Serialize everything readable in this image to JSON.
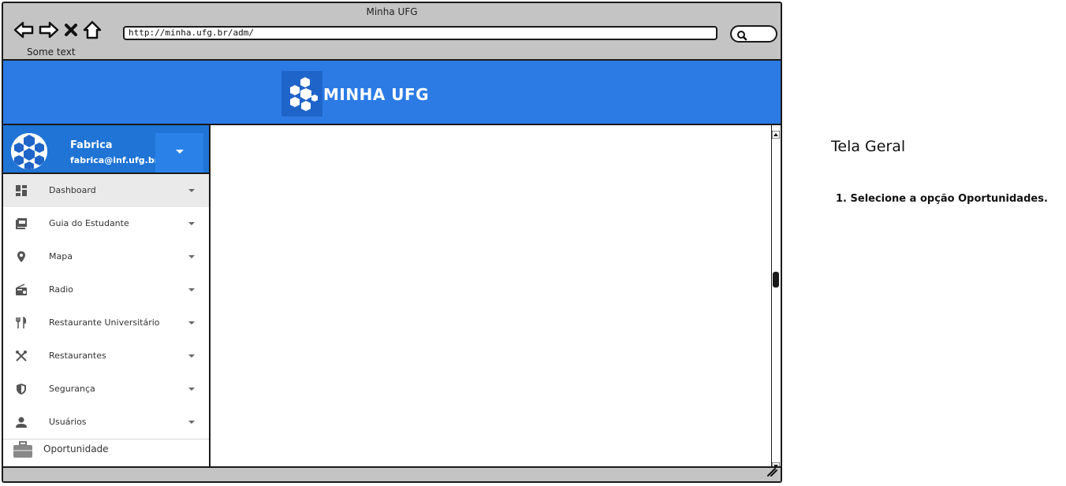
{
  "window": {
    "title": "Minha UFG",
    "url": "http://minha.ufg.br/adm/",
    "status_text": "Some text"
  },
  "browser_icons": [
    "back-icon",
    "forward-icon",
    "close-icon",
    "home-icon"
  ],
  "brand": {
    "name": "MINHA UFG",
    "color": "#2c7be5"
  },
  "profile": {
    "name": "Fabrica",
    "email": "fabrica@inf.ufg.br"
  },
  "menu": {
    "items": [
      {
        "label": "Dashboard",
        "icon": "dashboard-icon"
      },
      {
        "label": "Guia do Estudante",
        "icon": "pdf-icon"
      },
      {
        "label": "Mapa",
        "icon": "map-pin-icon"
      },
      {
        "label": "Radio",
        "icon": "radio-icon"
      },
      {
        "label": "Restaurante Universitário",
        "icon": "utensils-icon"
      },
      {
        "label": "Restaurantes",
        "icon": "crossed-utensils-icon"
      },
      {
        "label": "Segurança",
        "icon": "shield-icon"
      },
      {
        "label": "Usuários",
        "icon": "user-icon"
      }
    ],
    "opportunity_label": "Oportunidade"
  },
  "notes": {
    "title": "Tela Geral",
    "steps": [
      "1. Selecione a opção Oportunidades."
    ]
  }
}
